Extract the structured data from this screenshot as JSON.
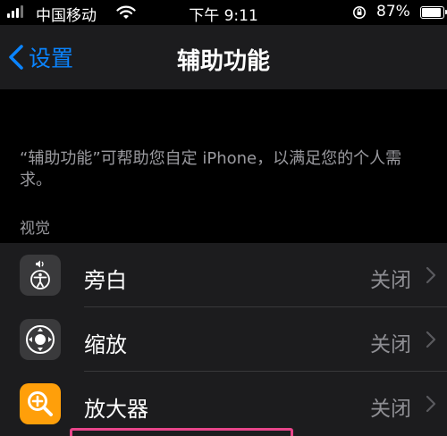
{
  "status_bar": {
    "carrier": "中国移动",
    "time": "下午 9:11",
    "battery_percent": "87%",
    "battery_level": 0.87
  },
  "nav": {
    "back_label": "设置",
    "title": "辅助功能"
  },
  "description": "“辅助功能”可帮助您自定 iPhone，以满足您的个人需求。",
  "section_header": "视觉",
  "items": [
    {
      "label": "旁白",
      "value": "关闭",
      "icon": "voiceover-icon",
      "icon_bg": "#3a3a3c"
    },
    {
      "label": "缩放",
      "value": "关闭",
      "icon": "zoom-icon",
      "icon_bg": "#3a3a3c"
    },
    {
      "label": "放大器",
      "value": "关闭",
      "icon": "magnifier-icon",
      "icon_bg": "#ff9f0a"
    }
  ],
  "colors": {
    "accent": "#0a84ff",
    "highlight": "#e8458a"
  }
}
